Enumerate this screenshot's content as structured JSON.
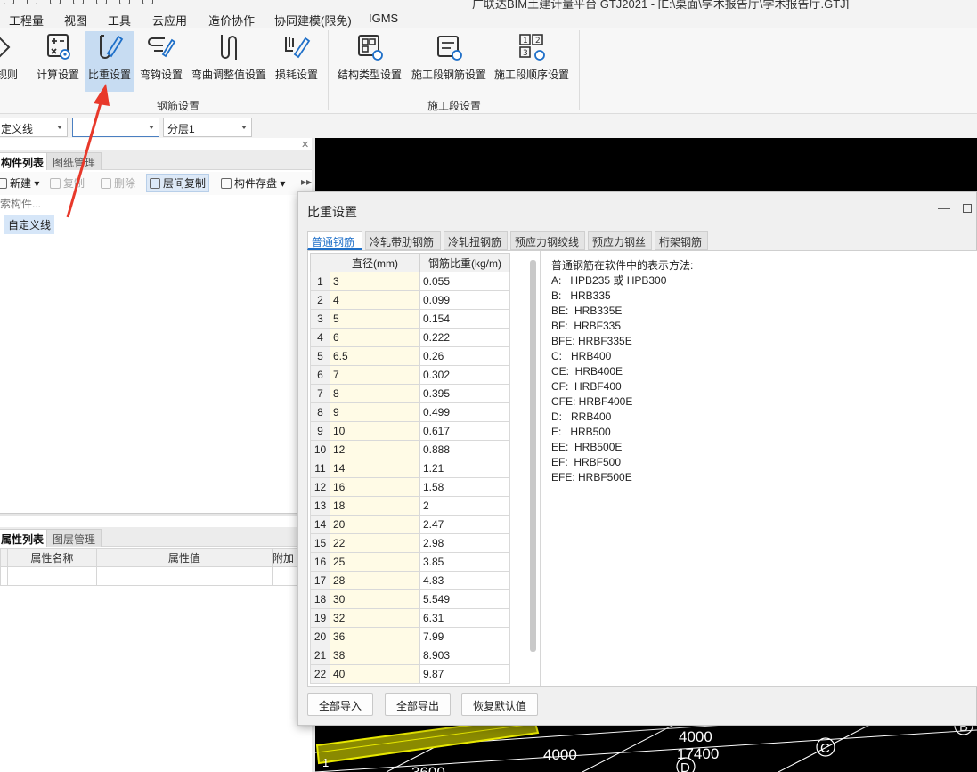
{
  "window": {
    "title": "广联达BIM土建计量平台 GTJ2021 - [E:\\桌面\\学术报告厅\\学术报告厅.GTJ]"
  },
  "menu": [
    "工程量",
    "视图",
    "工具",
    "云应用",
    "造价协作",
    "协同建模(限免)",
    "IGMS"
  ],
  "ribbon": {
    "left_cut_label": "规则",
    "rebar_group": {
      "label": "钢筋设置",
      "buttons": [
        {
          "label": "计算设置",
          "icon": "calc-settings-icon"
        },
        {
          "label": "比重设置",
          "icon": "density-settings-icon",
          "active": true
        },
        {
          "label": "弯钩设置",
          "icon": "hook-settings-icon"
        },
        {
          "label": "弯曲调整值设置",
          "icon": "bend-adjust-icon"
        },
        {
          "label": "损耗设置",
          "icon": "loss-settings-icon"
        }
      ]
    },
    "segment_group": {
      "label": "施工段设置",
      "buttons": [
        {
          "label": "结构类型设置",
          "icon": "structure-type-icon"
        },
        {
          "label": "施工段钢筋设置",
          "icon": "segment-rebar-icon"
        },
        {
          "label": "施工段顺序设置",
          "icon": "segment-order-icon"
        }
      ]
    }
  },
  "combos": {
    "first": "定义线",
    "second": "",
    "third": "分层1"
  },
  "left_panel": {
    "tabs": [
      "构件列表",
      "图纸管理"
    ],
    "toolbar": {
      "new": "新建",
      "copy": "复制",
      "delete": "删除",
      "floor_copy": "层间复制",
      "store": "构件存盘"
    },
    "search_placeholder": "索构件...",
    "tree_item": "自定义线",
    "prop_tabs": [
      "属性列表",
      "图层管理"
    ],
    "prop_headers": {
      "name": "属性名称",
      "value": "属性值",
      "extra": "附加"
    }
  },
  "dialog": {
    "title": "比重设置",
    "tabs": [
      "普通钢筋",
      "冷轧带肋钢筋",
      "冷轧扭钢筋",
      "预应力钢绞线",
      "预应力钢丝",
      "桁架钢筋"
    ],
    "columns": {
      "diameter": "直径(mm)",
      "density": "钢筋比重(kg/m)"
    },
    "rows": [
      {
        "n": "1",
        "d": "3",
        "w": "0.055"
      },
      {
        "n": "2",
        "d": "4",
        "w": "0.099"
      },
      {
        "n": "3",
        "d": "5",
        "w": "0.154"
      },
      {
        "n": "4",
        "d": "6",
        "w": "0.222"
      },
      {
        "n": "5",
        "d": "6.5",
        "w": "0.26"
      },
      {
        "n": "6",
        "d": "7",
        "w": "0.302"
      },
      {
        "n": "7",
        "d": "8",
        "w": "0.395"
      },
      {
        "n": "8",
        "d": "9",
        "w": "0.499"
      },
      {
        "n": "9",
        "d": "10",
        "w": "0.617"
      },
      {
        "n": "10",
        "d": "12",
        "w": "0.888"
      },
      {
        "n": "11",
        "d": "14",
        "w": "1.21"
      },
      {
        "n": "12",
        "d": "16",
        "w": "1.58"
      },
      {
        "n": "13",
        "d": "18",
        "w": "2"
      },
      {
        "n": "14",
        "d": "20",
        "w": "2.47"
      },
      {
        "n": "15",
        "d": "22",
        "w": "2.98"
      },
      {
        "n": "16",
        "d": "25",
        "w": "3.85"
      },
      {
        "n": "17",
        "d": "28",
        "w": "4.83"
      },
      {
        "n": "18",
        "d": "30",
        "w": "5.549"
      },
      {
        "n": "19",
        "d": "32",
        "w": "6.31"
      },
      {
        "n": "20",
        "d": "36",
        "w": "7.99"
      },
      {
        "n": "21",
        "d": "38",
        "w": "8.903"
      },
      {
        "n": "22",
        "d": "40",
        "w": "9.87"
      }
    ],
    "legend": [
      "普通钢筋在软件中的表示方法:",
      "A:   HPB235 或 HPB300",
      "B:   HRB335",
      "BE:  HRB335E",
      "BF:  HRBF335",
      "BFE: HRBF335E",
      "C:   HRB400",
      "CE:  HRB400E",
      "CF:  HRBF400",
      "CFE: HRBF400E",
      "D:   RRB400",
      "E:   HRB500",
      "EE:  HRB500E",
      "EF:  HRBF500",
      "EFE: HRBF500E"
    ],
    "buttons": {
      "import_all": "全部导入",
      "export_all": "全部导出",
      "restore": "恢复默认值"
    }
  },
  "viewport": {
    "dim_labels": [
      "4000",
      "17400",
      "4000",
      "3600"
    ],
    "axis_labels": [
      "C",
      "D",
      "B",
      "1"
    ]
  },
  "colors": {
    "accent": "#1e6fc8",
    "active_button": "#c7dcf2",
    "arrow": "#e8382a",
    "beam": "#e8e800"
  }
}
